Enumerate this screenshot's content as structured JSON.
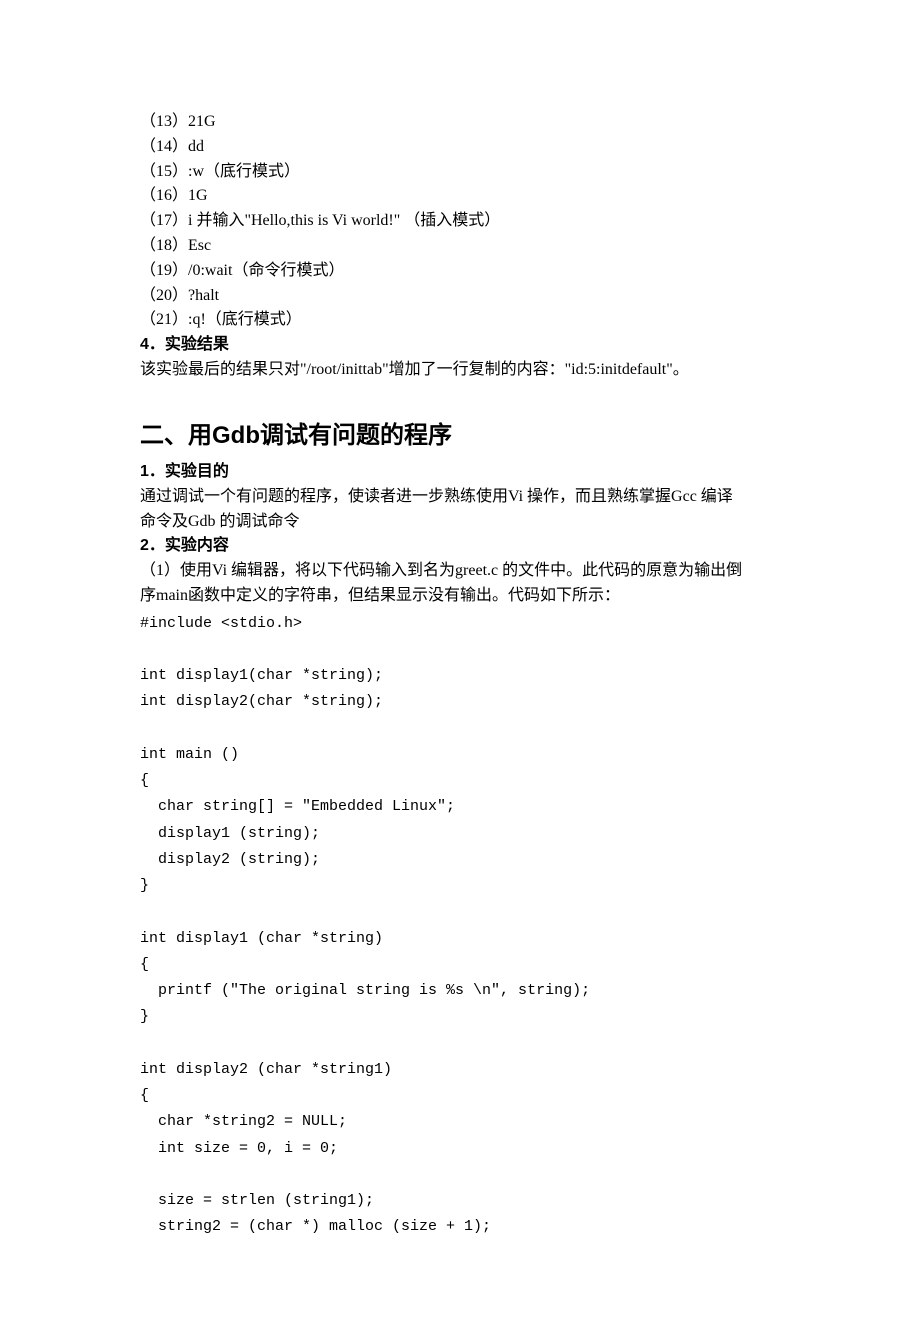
{
  "topList": {
    "items": [
      "（13）21G",
      "（14）dd",
      "（15）:w（底行模式）",
      "（16）1G",
      "（17）i 并输入\"Hello,this is Vi world!\" （插入模式）",
      "（18）Esc",
      "（19）/0:wait（命令行模式）",
      "（20）?halt",
      "（21）:q!（底行模式）"
    ]
  },
  "resultSection": {
    "heading": "4．实验结果",
    "body": "该实验最后的结果只对\"/root/inittab\"增加了一行复制的内容：\"id:5:initdefault\"。"
  },
  "section2": {
    "title": "二、用Gdb调试有问题的程序",
    "purposeHeading": "1．实验目的",
    "purposeBody1": "通过调试一个有问题的程序，使读者进一步熟练使用Vi 操作，而且熟练掌握Gcc 编译",
    "purposeBody2": "命令及Gdb 的调试命令",
    "contentHeading": "2．实验内容",
    "contentBody1": "（1）使用Vi 编辑器，将以下代码输入到名为greet.c 的文件中。此代码的原意为输出倒",
    "contentBody2": "序main函数中定义的字符串，但结果显示没有输出。代码如下所示：",
    "code": "#include <stdio.h>\n\nint display1(char *string);\nint display2(char *string);\n\nint main ()\n{\n  char string[] = \"Embedded Linux\";\n  display1 (string);\n  display2 (string);\n}\n\nint display1 (char *string)\n{\n  printf (\"The original string is %s \\n\", string);\n}\n\nint display2 (char *string1)\n{\n  char *string2 = NULL;\n  int size = 0, i = 0;\n\n  size = strlen (string1);\n  string2 = (char *) malloc (size + 1);"
  }
}
